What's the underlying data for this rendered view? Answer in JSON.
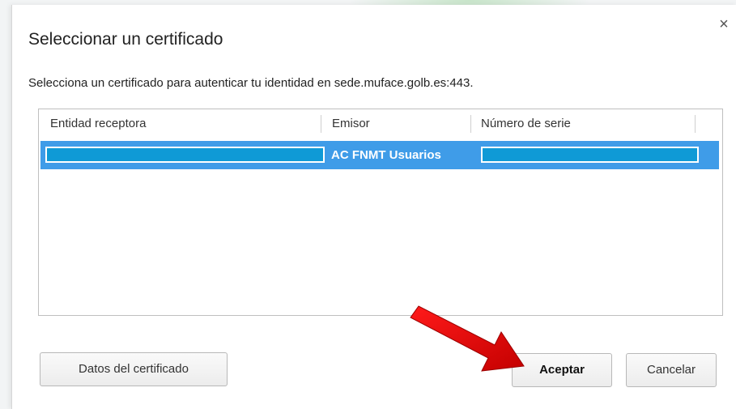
{
  "dialog": {
    "title": "Seleccionar un certificado",
    "subtitle": "Selecciona un certificado para autenticar tu identidad en sede.muface.golb.es:443.",
    "close_icon": "close-icon"
  },
  "table": {
    "columns": [
      "Entidad receptora",
      "Emisor",
      "Número de serie"
    ],
    "rows": [
      {
        "entidad_receptora": "",
        "emisor": "AC FNMT Usuarios",
        "numero_serie": "",
        "selected": true
      }
    ]
  },
  "buttons": {
    "datos": "Datos del certificado",
    "aceptar": "Aceptar",
    "cancelar": "Cancelar"
  },
  "colors": {
    "selected_row": "#3f9ce8",
    "redaction_fill": "#0f9ad6",
    "annotation_arrow": "#e10000"
  },
  "annotations": {
    "arrow": "red-arrow-pointing-to-aceptar"
  }
}
